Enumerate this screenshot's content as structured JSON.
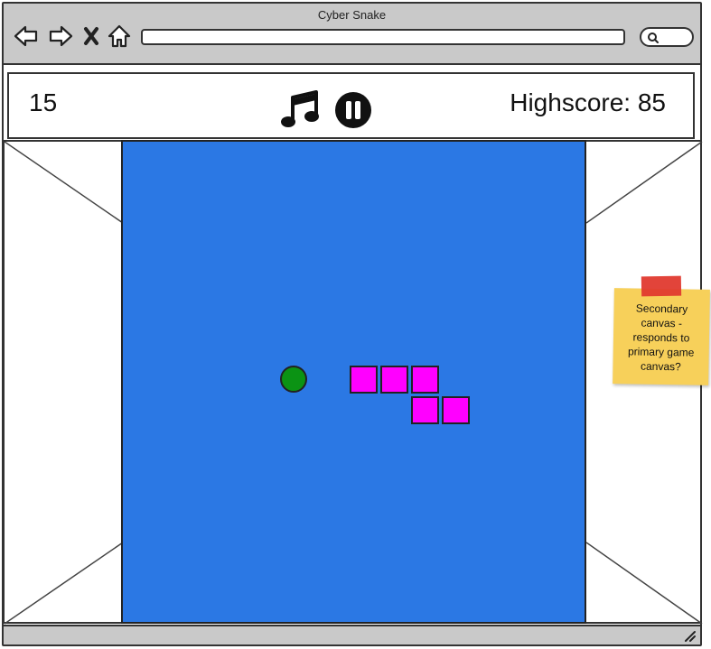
{
  "window": {
    "title": "Cyber Snake"
  },
  "toolbar": {
    "icons": [
      "back-icon",
      "forward-icon",
      "stop-icon",
      "home-icon",
      "search-icon"
    ]
  },
  "game": {
    "score": "15",
    "highscore_text": "Highscore: 85",
    "icons": [
      "music-icon",
      "pause-icon"
    ],
    "colors": {
      "board": "#2b78e4",
      "snake": "#ff00ff",
      "food": "#0b9314"
    }
  },
  "note": {
    "text": "Secondary canvas - responds to primary game canvas?",
    "color": "#f7d05a"
  }
}
